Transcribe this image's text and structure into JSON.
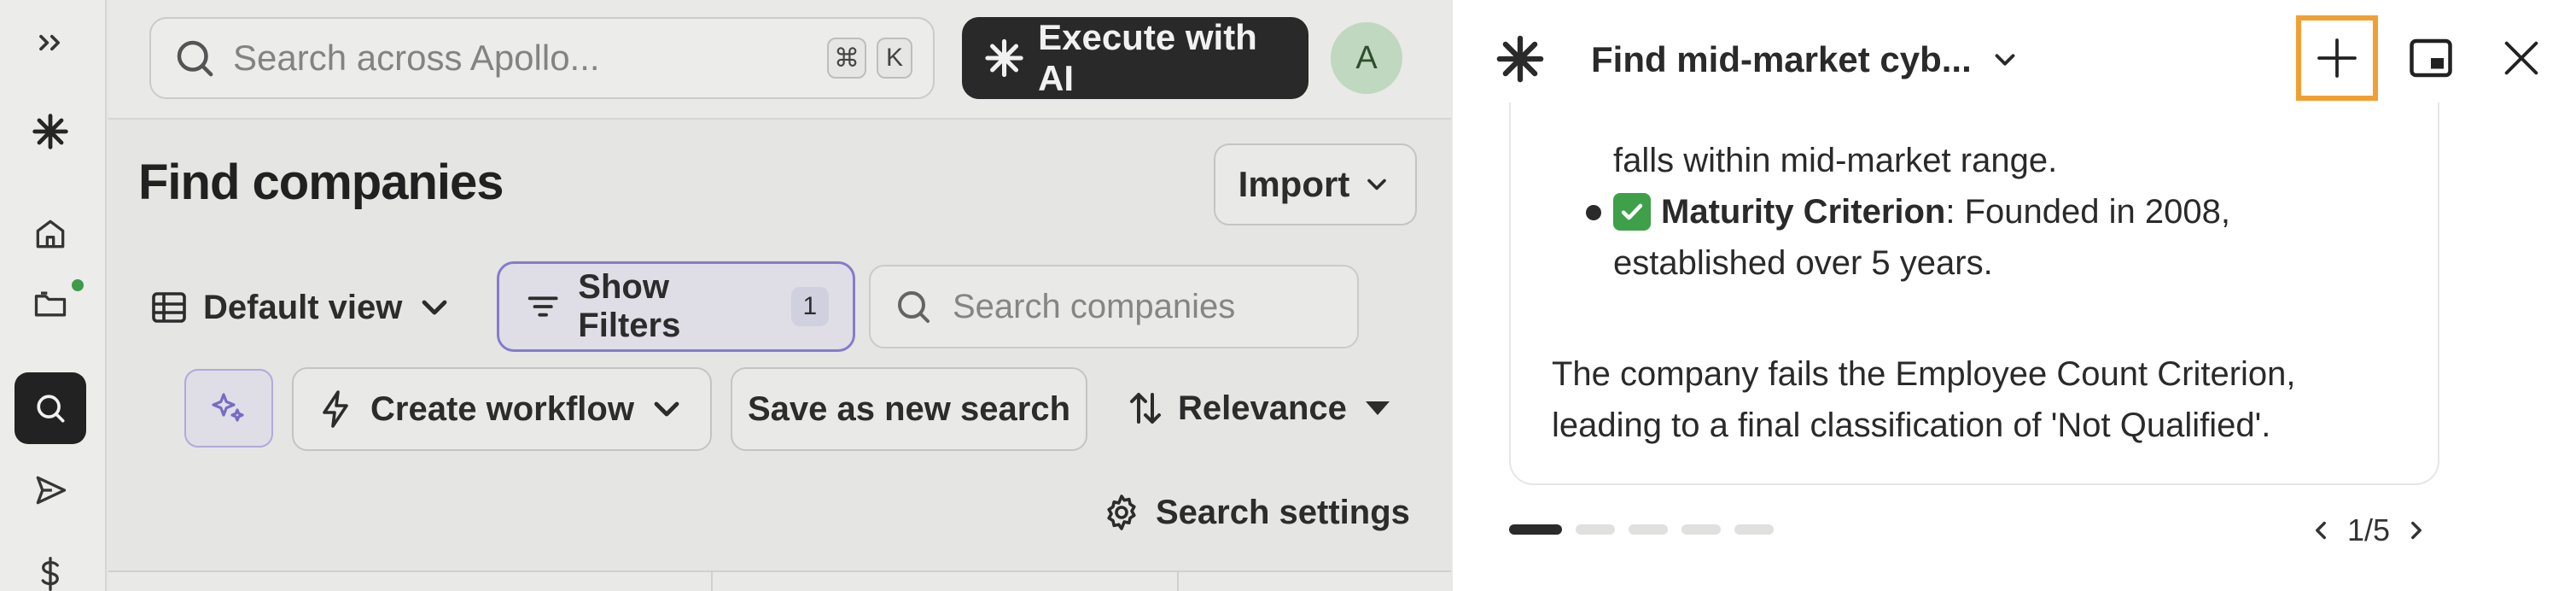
{
  "sidebar": {
    "items": [
      {
        "icon": "chevrons-right-icon"
      },
      {
        "icon": "apollo-logo-icon"
      },
      {
        "icon": "home-icon"
      },
      {
        "icon": "folder-icon"
      },
      {
        "icon": "search-icon",
        "active": true
      },
      {
        "icon": "send-icon"
      },
      {
        "icon": "dollar-icon"
      }
    ]
  },
  "header": {
    "search_placeholder": "Search across Apollo...",
    "shortcut_keys": [
      "⌘",
      "K"
    ],
    "execute_label": "Execute with AI",
    "avatar_initial": "A"
  },
  "main": {
    "title": "Find companies",
    "import_label": "Import",
    "default_view_label": "Default view",
    "show_filters_label": "Show Filters",
    "filters_count": "1",
    "company_search_placeholder": "Search companies",
    "create_workflow_label": "Create workflow",
    "save_search_label": "Save as new search",
    "sort_label": "Relevance",
    "search_settings_label": "Search settings"
  },
  "panel": {
    "conversation_title": "Find mid-market cyb...",
    "message": {
      "continued_text": "falls within mid-market range.",
      "criterion_label": "Maturity Criterion",
      "criterion_text_1": ": Founded in 2008,",
      "criterion_text_2": "established over 5 years.",
      "summary_1": "The company fails the Employee Count Criterion,",
      "summary_2": "leading to a final classification of 'Not Qualified'."
    },
    "pager": {
      "current": 1,
      "total": 5,
      "label": "1/5"
    }
  },
  "colors": {
    "highlight_border": "#f0a032",
    "accent_purple": "#8a80d6",
    "execute_bg": "#262626",
    "check_green": "#3ea14a"
  }
}
